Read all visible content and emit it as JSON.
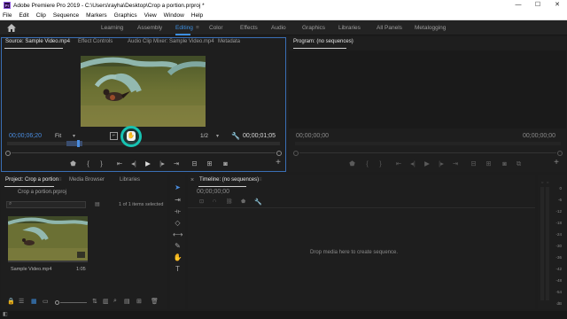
{
  "titlebar": {
    "logo": "Pr",
    "title": "Adobe Premiere Pro 2019 - C:\\Users\\rayha\\Desktop\\Crop a portion.prproj *",
    "minimize": "—",
    "maximize": "☐",
    "close": "✕"
  },
  "menu": [
    "File",
    "Edit",
    "Clip",
    "Sequence",
    "Markers",
    "Graphics",
    "View",
    "Window",
    "Help"
  ],
  "workspaces": [
    "Learning",
    "Assembly",
    "Editing",
    "Color",
    "Effects",
    "Audio",
    "Graphics",
    "Libraries",
    "All Panels",
    "Metalogging"
  ],
  "active_workspace": "Editing",
  "source_panel": {
    "tabs": [
      "Source: Sample Video.mp4",
      "Effect Controls",
      "Audio Clip Mixer: Sample Video.mp4",
      "Metadata"
    ],
    "menu_icon": "≡",
    "timecode_in": "00;00;06;20",
    "fit": "Fit",
    "fraction": "1/2",
    "duration": "00;00;01;05",
    "add_button": "+"
  },
  "program_panel": {
    "tab": "Program: (no sequences)",
    "menu_icon": "≡",
    "timecode_left": "00;00;00;00",
    "timecode_right": "00;00;00;00",
    "add_button": "+"
  },
  "project_panel": {
    "tabs": [
      "Project: Crop a portion",
      "Media Browser",
      "Libraries"
    ],
    "menu_icon": "≡",
    "project_file": "Crop a portion.prproj",
    "items_selected": "1 of 1 items selected",
    "clip_name": "Sample Video.mp4",
    "clip_duration": "1:05"
  },
  "timeline_panel": {
    "tab": "Timeline: (no sequences)",
    "menu_icon": "≡",
    "timecode": "00;00;00;00",
    "drop_text": "Drop media here to create sequence."
  },
  "audio_meter": {
    "labels": [
      "0",
      "-6",
      "-12",
      "-18",
      "-24",
      "-30",
      "-36",
      "-42",
      "-48",
      "-54",
      "dB"
    ]
  },
  "colors": {
    "accent_blue": "#3d8fe0",
    "cursor_ring": "#17c3b2",
    "panel_bg": "#1e1e1e",
    "titlebar_bg": "#ffffff"
  }
}
